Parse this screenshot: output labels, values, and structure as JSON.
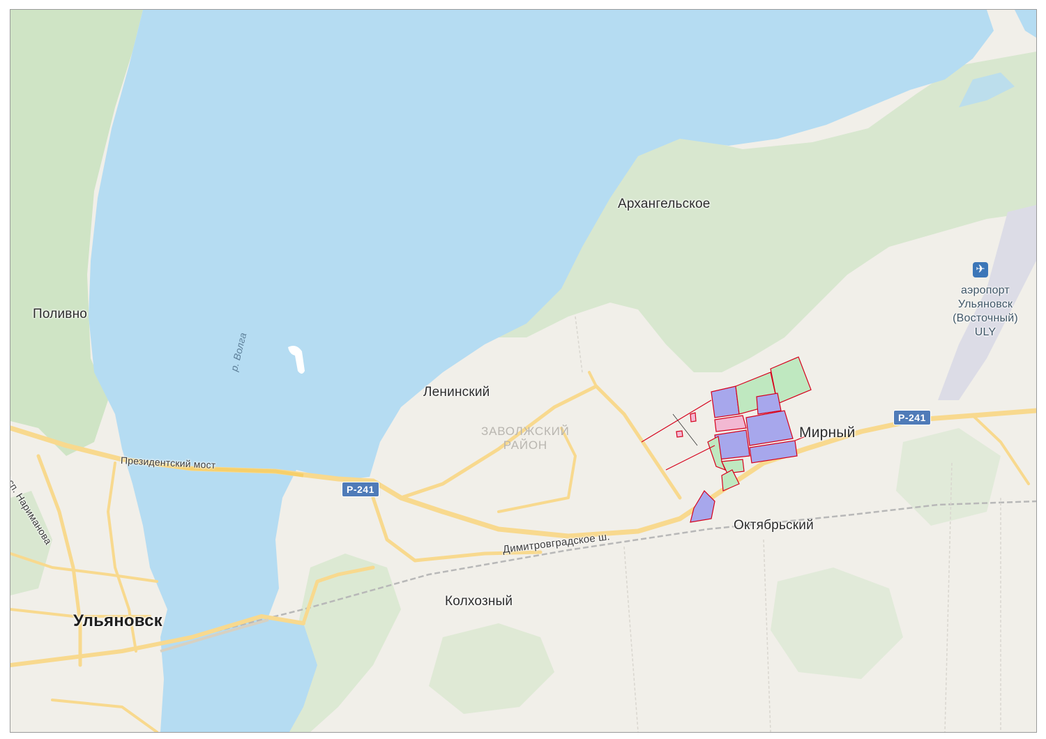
{
  "map": {
    "places": {
      "ulyanovsk": "Ульяновск",
      "polivno": "Поливно",
      "leninsky": "Ленинский",
      "district": "ЗАВОЛЖСКИЙ РАЙОН",
      "district_line1": "ЗАВОЛЖСКИЙ",
      "district_line2": "РАЙОН",
      "arkhangelskoe": "Архангельское",
      "mirny": "Мирный",
      "oktyabrsky": "Октябрьский",
      "kolkhozny": "Колхозный"
    },
    "water": {
      "river": "р. Волга"
    },
    "roads": {
      "bridge": "Президентский мост",
      "highway": "Димитровградское ш.",
      "avenue": "осп. Нариманова",
      "route_shield_1": "Р-241",
      "route_shield_2": "Р-241"
    },
    "airport": {
      "line1": "аэропорт",
      "line2": "Ульяновск",
      "line3": "(Восточный)",
      "code": "ULY",
      "icon": "airplane-icon"
    },
    "colors": {
      "water": "#b5dcf2",
      "land": "#f1efe9",
      "forest": "#cfe4c5",
      "road_major": "#f8d98e",
      "parcel_outline": "#d6001c",
      "parcel_blue": "#a7a7ec",
      "parcel_green": "#bfe8c0",
      "parcel_pink": "#f2b8d2"
    }
  }
}
